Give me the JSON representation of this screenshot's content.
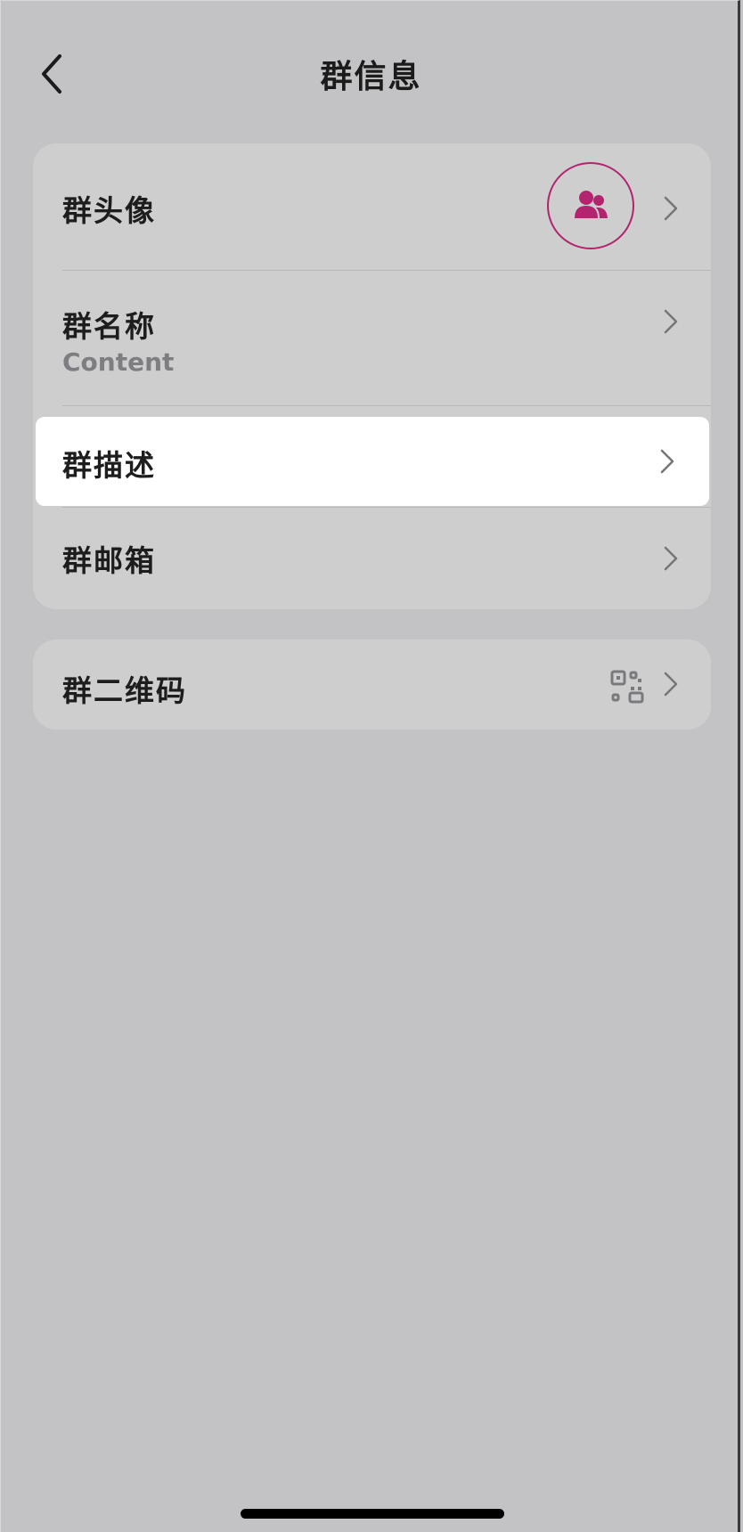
{
  "header": {
    "title": "群信息"
  },
  "list": {
    "avatar_label": "群头像",
    "name_label": "群名称",
    "name_value": "Content",
    "description_label": "群描述",
    "email_label": "群邮箱",
    "qrcode_label": "群二维码"
  },
  "colors": {
    "accent": "#b2246e",
    "background": "#c3c3c5",
    "card": "#cecece",
    "highlight": "#ffffff"
  },
  "icons": [
    "back-chevron-icon",
    "group-users-icon",
    "qr-code-icon",
    "chevron-right-icon"
  ]
}
